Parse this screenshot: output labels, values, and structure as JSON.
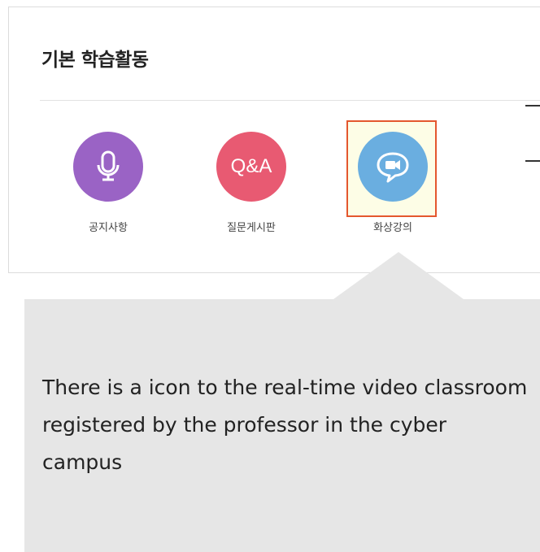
{
  "section": {
    "title": "기본 학습활동"
  },
  "activities": [
    {
      "label": "공지사항",
      "icon": "microphone-icon",
      "color": "#9a63c5"
    },
    {
      "label": "질문게시판",
      "icon_text": "Q&A",
      "color": "#e85a72"
    },
    {
      "label": "화상강의",
      "icon": "video-chat-icon",
      "color": "#6aaee0",
      "highlighted": true
    }
  ],
  "callout": {
    "text": "There is a icon to the real-time video classroom registered by the professor in the cyber campus"
  },
  "colors": {
    "highlight_border": "#e4572e",
    "highlight_fill": "#fdfde6",
    "callout_bg": "#e6e6e6"
  }
}
